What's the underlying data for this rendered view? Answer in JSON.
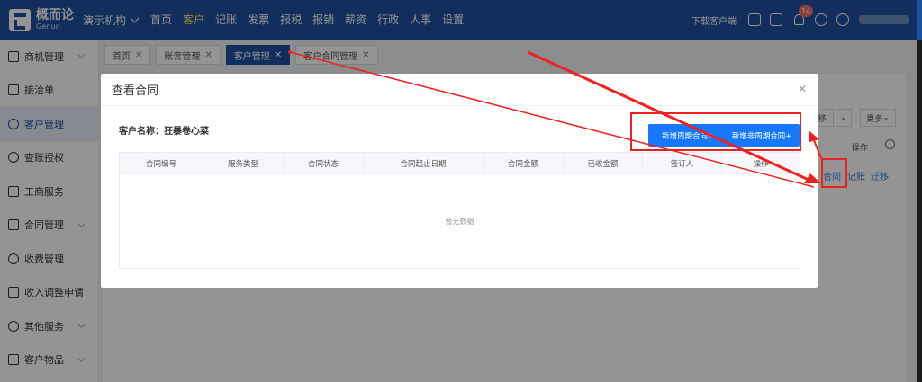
{
  "brand": {
    "name_cn": "概而论",
    "name_en": "Gerlun"
  },
  "org_selector": {
    "label": "演示机构"
  },
  "nav": [
    {
      "label": "首页",
      "active": false
    },
    {
      "label": "客户",
      "active": true
    },
    {
      "label": "记账",
      "active": false
    },
    {
      "label": "发票",
      "active": false
    },
    {
      "label": "报税",
      "active": false
    },
    {
      "label": "报销",
      "active": false
    },
    {
      "label": "薪资",
      "active": false
    },
    {
      "label": "行政",
      "active": false
    },
    {
      "label": "人事",
      "active": false
    },
    {
      "label": "设置",
      "active": false
    }
  ],
  "topright": {
    "download_label": "下载客户端",
    "notification_count": "14"
  },
  "sidebar": {
    "items": [
      {
        "label": "商机管理",
        "icon": "opportunity-icon",
        "has_caret": true,
        "active": false
      },
      {
        "label": "接洽单",
        "icon": "contact-form-icon",
        "has_caret": false,
        "active": false
      },
      {
        "label": "客户管理",
        "icon": "customer-icon",
        "has_caret": false,
        "active": true
      },
      {
        "label": "查账授权",
        "icon": "audit-auth-icon",
        "has_caret": false,
        "active": false
      },
      {
        "label": "工商服务",
        "icon": "business-service-icon",
        "has_caret": false,
        "active": false
      },
      {
        "label": "合同管理",
        "icon": "contract-icon",
        "has_caret": true,
        "active": false
      },
      {
        "label": "收费管理",
        "icon": "fee-icon",
        "has_caret": false,
        "active": false
      },
      {
        "label": "收入调整申请",
        "icon": "income-adjust-icon",
        "has_caret": false,
        "active": false
      },
      {
        "label": "其他服务",
        "icon": "other-service-icon",
        "has_caret": true,
        "active": false
      },
      {
        "label": "客户物品",
        "icon": "customer-items-icon",
        "has_caret": true,
        "active": false
      }
    ]
  },
  "tabs": [
    {
      "label": "首页",
      "active": false
    },
    {
      "label": "账套管理",
      "active": false
    },
    {
      "label": "客户管理",
      "active": true
    },
    {
      "label": "客户合同管理",
      "active": false
    }
  ],
  "background": {
    "transfer_btn": "移",
    "more_btn": "更多",
    "ops_header": "操作",
    "row_links": [
      "合同",
      "记账",
      "迁移"
    ]
  },
  "modal": {
    "title": "查看合同",
    "customer_label": "客户名称：狂暴卷心菜",
    "btn_periodic": "新增周期合同+",
    "btn_nonperiodic": "新增非周期合同+",
    "columns": [
      "合同编号",
      "服务类型",
      "合同状态",
      "合同起止日期",
      "合同金额",
      "已收金额",
      "签订人",
      "操作"
    ],
    "empty_text": "暂无数据"
  },
  "colors": {
    "nav_bg": "#1e50a0",
    "primary": "#1677ff",
    "annotation": "#f02020",
    "active_nav": "#ffe45c"
  }
}
